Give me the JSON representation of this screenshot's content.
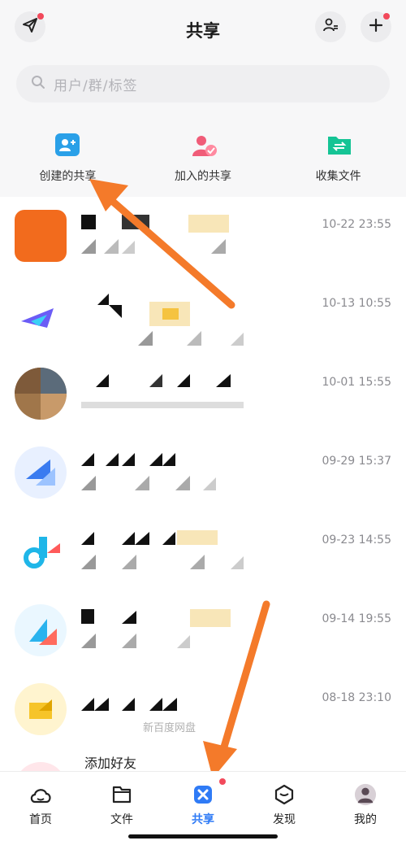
{
  "header": {
    "title": "共享",
    "send_icon": "paper-plane-icon",
    "contacts_icon": "person-list-icon",
    "add_icon": "plus-icon"
  },
  "search": {
    "placeholder": "用户/群/标签"
  },
  "quick_actions": [
    {
      "label": "创建的共享",
      "icon": "create-share-icon",
      "color": "#2aa0e8"
    },
    {
      "label": "加入的共享",
      "icon": "joined-share-icon",
      "color": "#f05c78"
    },
    {
      "label": "收集文件",
      "icon": "collect-folder-icon",
      "color": "#15c495"
    }
  ],
  "shares": [
    {
      "time": "10-22 23:55",
      "avatar_color": "#f26b1d"
    },
    {
      "time": "10-13 10:55",
      "avatar_color": "#6b5cf6"
    },
    {
      "time": "10-01 15:55",
      "avatar_color": "#a0764a"
    },
    {
      "time": "09-29 15:37",
      "avatar_color": "#3a7bf0"
    },
    {
      "time": "09-23 14:55",
      "avatar_color": "#1fb6e8"
    },
    {
      "time": "09-14 19:55",
      "avatar_color": "#ff6b5e"
    },
    {
      "time": "08-18 23:10",
      "avatar_color": "#f6c429",
      "subtitle": "新百度网盘"
    },
    {
      "title": "添加好友"
    }
  ],
  "tabs": [
    {
      "label": "首页",
      "icon": "home-cloud-icon"
    },
    {
      "label": "文件",
      "icon": "folder-icon"
    },
    {
      "label": "共享",
      "icon": "share-icon",
      "active": true
    },
    {
      "label": "发现",
      "icon": "discover-icon"
    },
    {
      "label": "我的",
      "icon": "avatar"
    }
  ],
  "colors": {
    "accent": "#2f7bf6",
    "badge": "#f2495b",
    "arrow": "#f47a2a"
  }
}
